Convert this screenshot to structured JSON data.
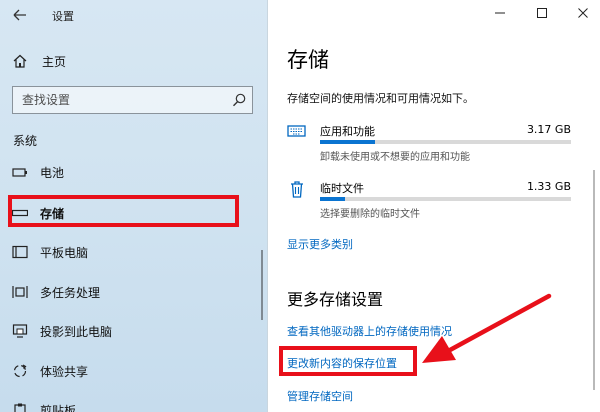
{
  "window": {
    "title": "设置"
  },
  "sidebar": {
    "home_label": "主页",
    "search_placeholder": "查找设置",
    "section_label": "系统",
    "items": [
      {
        "label": "电池",
        "icon": "battery-icon"
      },
      {
        "label": "存储",
        "icon": "storage-icon",
        "active": true
      },
      {
        "label": "平板电脑",
        "icon": "tablet-icon"
      },
      {
        "label": "多任务处理",
        "icon": "multitasking-icon"
      },
      {
        "label": "投影到此电脑",
        "icon": "project-icon"
      },
      {
        "label": "体验共享",
        "icon": "shared-experience-icon"
      },
      {
        "label": "剪贴板",
        "icon": "clipboard-icon"
      }
    ]
  },
  "main": {
    "title": "存储",
    "description": "存储空间的使用情况和可用情况如下。",
    "storage_items": [
      {
        "name": "应用和功能",
        "size": "3.17 GB",
        "subtitle": "卸载未使用或不想要的应用和功能",
        "usage_fraction": 0.22,
        "icon": "apps-icon"
      },
      {
        "name": "临时文件",
        "size": "1.33 GB",
        "subtitle": "选择要删除的临时文件",
        "usage_fraction": 0.1,
        "icon": "trash-icon"
      }
    ],
    "show_more_link": "显示更多类别",
    "more_settings_heading": "更多存储设置",
    "links": [
      "查看其他驱动器上的存储使用情况",
      "更改新内容的保存位置",
      "管理存储空间"
    ]
  },
  "colors": {
    "accent": "#0067c0",
    "bar_fill": "#0a74d1",
    "annotation": "#e8101a"
  }
}
